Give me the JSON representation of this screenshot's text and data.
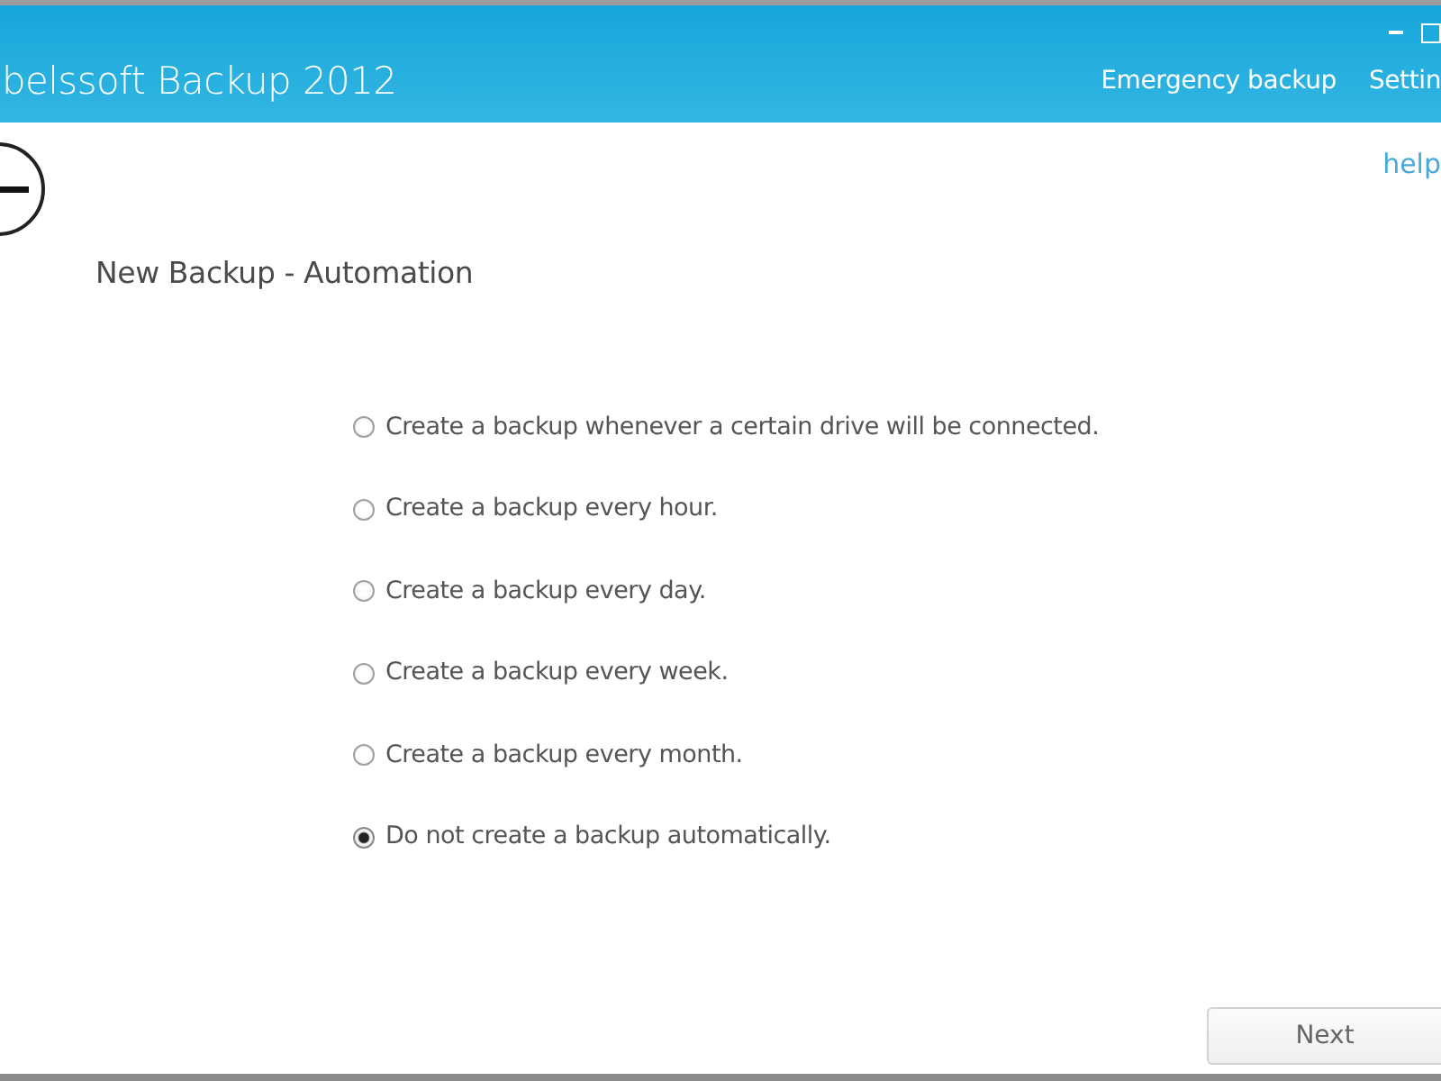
{
  "window": {
    "title": "belssoft Backup 2012"
  },
  "menu": [
    {
      "label": "Emergency backup"
    },
    {
      "label": "Settin"
    }
  ],
  "help_link": {
    "label": "help"
  },
  "page_title": "New Backup - Automation",
  "options": [
    {
      "label": "Create a backup whenever a certain drive will be connected.",
      "selected": false
    },
    {
      "label": "Create a backup every hour.",
      "selected": false
    },
    {
      "label": "Create a backup every day.",
      "selected": false
    },
    {
      "label": "Create a backup every week.",
      "selected": false
    },
    {
      "label": "Create a backup every month.",
      "selected": false
    },
    {
      "label": "Do not create a backup automatically.",
      "selected": true
    }
  ],
  "buttons": [
    {
      "label": "Next"
    }
  ]
}
